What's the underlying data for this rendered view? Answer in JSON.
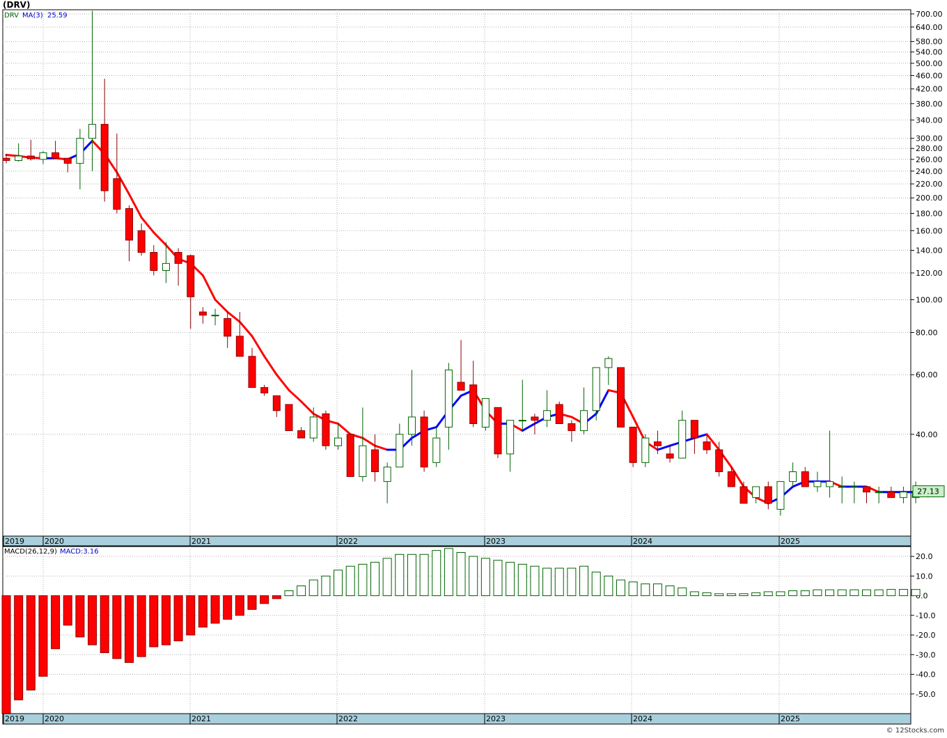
{
  "title": "(DRV)",
  "watermark": "© 12Stocks.com",
  "price_panel": {
    "symbol": "DRV",
    "ma_label": "MA(3)",
    "ma_value": "25.59",
    "last_price": "27.13"
  },
  "macd_panel": {
    "label": "MACD(26,12,9)",
    "value_label": "MACD:3.16"
  },
  "colors": {
    "up_candle": "#006400",
    "down_candle": "#ff0000",
    "ma_rising": "#0000ff",
    "ma_falling": "#ff0000",
    "macd_positive": "#006400",
    "macd_negative": "#ff0000",
    "date_strip": "#a8cfdb",
    "last_price_box": "#c8f0c8"
  },
  "chart_data": [
    {
      "type": "candlestick",
      "name": "DRV",
      "scale": "log",
      "ylim": [
        20,
        720
      ],
      "y_ticks": [
        "40.00",
        "60.00",
        "80.00",
        "100.00",
        "120.00",
        "140.00",
        "160.00",
        "180.00",
        "200.00",
        "220.00",
        "240.00",
        "260.00",
        "280.00",
        "300.00",
        "340.00",
        "380.00",
        "420.00",
        "460.00",
        "500.00",
        "540.00",
        "580.00",
        "640.00",
        "700.00"
      ],
      "x_labels": [
        "2019",
        "2020",
        "2021",
        "2022",
        "2023",
        "2024",
        "2025"
      ],
      "ohlc": [
        [
          262,
          270,
          253,
          258
        ],
        [
          258,
          290,
          256,
          266
        ],
        [
          266,
          297,
          258,
          261
        ],
        [
          260,
          275,
          252,
          272
        ],
        [
          272,
          295,
          264,
          262
        ],
        [
          262,
          262,
          238,
          253
        ],
        [
          253,
          320,
          212,
          300
        ],
        [
          300,
          715,
          240,
          330
        ],
        [
          330,
          450,
          195,
          210
        ],
        [
          228,
          310,
          180,
          185
        ],
        [
          186,
          190,
          130,
          150
        ],
        [
          160,
          168,
          135,
          138
        ],
        [
          138,
          145,
          118,
          122
        ],
        [
          122,
          148,
          112,
          128
        ],
        [
          138,
          142,
          110,
          128
        ],
        [
          135,
          136,
          82,
          102
        ],
        [
          92,
          95,
          85,
          90
        ],
        [
          90,
          94,
          84,
          90
        ],
        [
          88,
          92,
          72,
          78
        ],
        [
          78,
          92,
          70,
          68
        ],
        [
          68,
          72,
          55,
          55
        ],
        [
          55,
          56,
          52,
          53
        ],
        [
          52,
          52,
          45,
          47
        ],
        [
          49,
          49,
          41,
          41
        ],
        [
          41,
          42,
          39,
          39
        ],
        [
          39,
          48,
          38,
          45
        ],
        [
          46,
          47,
          36,
          37
        ],
        [
          37,
          43,
          36,
          39
        ],
        [
          40,
          40,
          30,
          30
        ],
        [
          30,
          48,
          29,
          37
        ],
        [
          36,
          40,
          29,
          31
        ],
        [
          29,
          33,
          25,
          32
        ],
        [
          32,
          43,
          32,
          40
        ],
        [
          40,
          62,
          37,
          45
        ],
        [
          45,
          47,
          31,
          32
        ],
        [
          33,
          42,
          32,
          39
        ],
        [
          42,
          65,
          36,
          62
        ],
        [
          57,
          76,
          56,
          54
        ],
        [
          56,
          66,
          42,
          43
        ],
        [
          42,
          47,
          41,
          51
        ],
        [
          48,
          48,
          34,
          35
        ],
        [
          35,
          44,
          31,
          44
        ],
        [
          44,
          58,
          41,
          44
        ],
        [
          45,
          46,
          40,
          44
        ],
        [
          44,
          54,
          42,
          47
        ],
        [
          49,
          50,
          44,
          43
        ],
        [
          43,
          44,
          38,
          41
        ],
        [
          41,
          55,
          40,
          47
        ],
        [
          47,
          63,
          44,
          63
        ],
        [
          63,
          68,
          56,
          67
        ],
        [
          63,
          63,
          42,
          42
        ],
        [
          42,
          42,
          32,
          33
        ],
        [
          33,
          40,
          32,
          39
        ],
        [
          38,
          41,
          35,
          37
        ],
        [
          35,
          37,
          33,
          34
        ],
        [
          34,
          47,
          34,
          44
        ],
        [
          44,
          44,
          35,
          39
        ],
        [
          38,
          40,
          35,
          36
        ],
        [
          36,
          38,
          30,
          31
        ],
        [
          31,
          32,
          28,
          28
        ],
        [
          28,
          29,
          25,
          25
        ],
        [
          26,
          28,
          25,
          28
        ],
        [
          28,
          29,
          24,
          25
        ],
        [
          24,
          29,
          23,
          29
        ],
        [
          29,
          33,
          28,
          31
        ],
        [
          31,
          32,
          28,
          28
        ],
        [
          28,
          31,
          27,
          29
        ],
        [
          28,
          41,
          26,
          29
        ],
        [
          28,
          30,
          25,
          28
        ],
        [
          28,
          29,
          25,
          28
        ],
        [
          28,
          28,
          25,
          27
        ],
        [
          27,
          28,
          25,
          27
        ],
        [
          27,
          28,
          26,
          26
        ],
        [
          26,
          28,
          25,
          27
        ],
        [
          26,
          29,
          25,
          27
        ],
        [
          27,
          28,
          26,
          28
        ]
      ],
      "ma": [
        268,
        266,
        263,
        262,
        262,
        260,
        270,
        295,
        270,
        238,
        205,
        175,
        158,
        145,
        132,
        128,
        118,
        100,
        92,
        86,
        78,
        68,
        60,
        54,
        50,
        46,
        44,
        43,
        40,
        39,
        37,
        36,
        36,
        39,
        41,
        42,
        47,
        52,
        54,
        47,
        43,
        43,
        41,
        43,
        45,
        46,
        45,
        43,
        46,
        54,
        53,
        45,
        38,
        36,
        37,
        38,
        39,
        40,
        36,
        32,
        28,
        26,
        25,
        26,
        28,
        29,
        29,
        29,
        28,
        28,
        28,
        27,
        27,
        27,
        27,
        28
      ]
    },
    {
      "type": "bar",
      "name": "MACD(26,12,9)",
      "ylim": [
        -60,
        25
      ],
      "y_ticks": [
        "20.0",
        "10.0",
        "0.0",
        "-10.0",
        "-20.0",
        "-30.0",
        "-40.0",
        "-50.0"
      ],
      "x_labels": [
        "2019",
        "2020",
        "2021",
        "2022",
        "2023",
        "2024",
        "2025"
      ],
      "values": [
        -60,
        -53,
        -48,
        -41,
        -27,
        -15,
        -21,
        -25,
        -29,
        -32,
        -34,
        -31,
        -26,
        -25,
        -23,
        -20,
        -16,
        -14,
        -12,
        -10,
        -7,
        -4,
        -1.5,
        2.5,
        5,
        8,
        10,
        13,
        15,
        16,
        17,
        19,
        21,
        21,
        21,
        23,
        24,
        22,
        20,
        19,
        18,
        17,
        16,
        15,
        14,
        14,
        14,
        15,
        12,
        10,
        8,
        7,
        6,
        6,
        5,
        4,
        2,
        1.5,
        1,
        1,
        1,
        1.5,
        2,
        2,
        2.5,
        2.5,
        3,
        3,
        3,
        3,
        3,
        3,
        3.2,
        3.2,
        3.16
      ]
    }
  ]
}
